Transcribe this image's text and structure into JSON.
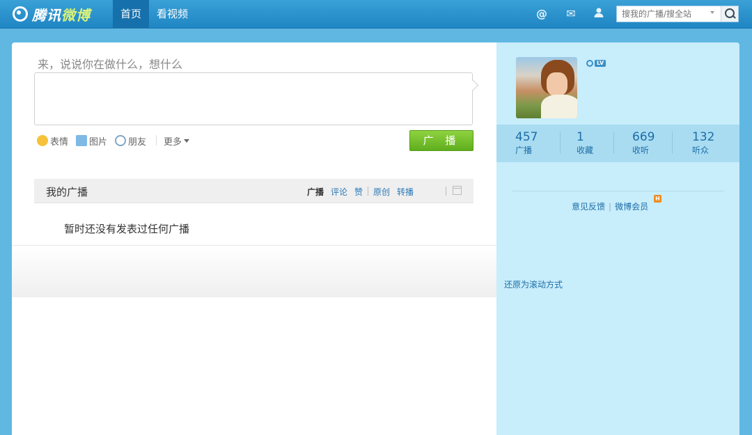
{
  "header": {
    "logo_text_main": "腾讯",
    "logo_text_accent": "微博",
    "nav": [
      {
        "label": "首页",
        "active": true
      },
      {
        "label": "看视频",
        "active": false
      }
    ],
    "icons": [
      "at-icon",
      "mail-icon",
      "user-icon"
    ],
    "search": {
      "placeholder": "搜我的广播/搜全站"
    }
  },
  "composer": {
    "hint": "来，说说你在做什么，想什么",
    "tools": {
      "emoji": "表情",
      "picture": "图片",
      "friend": "朋友",
      "more": "更多"
    },
    "submit_label": "广 播"
  },
  "feed": {
    "title": "我的广播",
    "filters": {
      "broadcast": "广播",
      "comment": "评论",
      "like": "赞",
      "original": "原创",
      "repost": "转播"
    },
    "empty_text": "暂时还没有发表过任何广播"
  },
  "profile": {
    "level_label": "LV",
    "stats": [
      {
        "value": "457",
        "label": "广播"
      },
      {
        "value": "1",
        "label": "收藏"
      },
      {
        "value": "669",
        "label": "收听"
      },
      {
        "value": "132",
        "label": "听众"
      }
    ],
    "links": {
      "feedback": "意见反馈",
      "vip": "微博会员",
      "vip_badge": "H"
    },
    "restore": "还原为滚动方式"
  },
  "colors": {
    "background": "#5fb7e2",
    "topbar": "#1f86c4",
    "accent_green": "#6cbf26",
    "link_blue": "#1d6da7",
    "side_panel": "#c8edfb"
  }
}
